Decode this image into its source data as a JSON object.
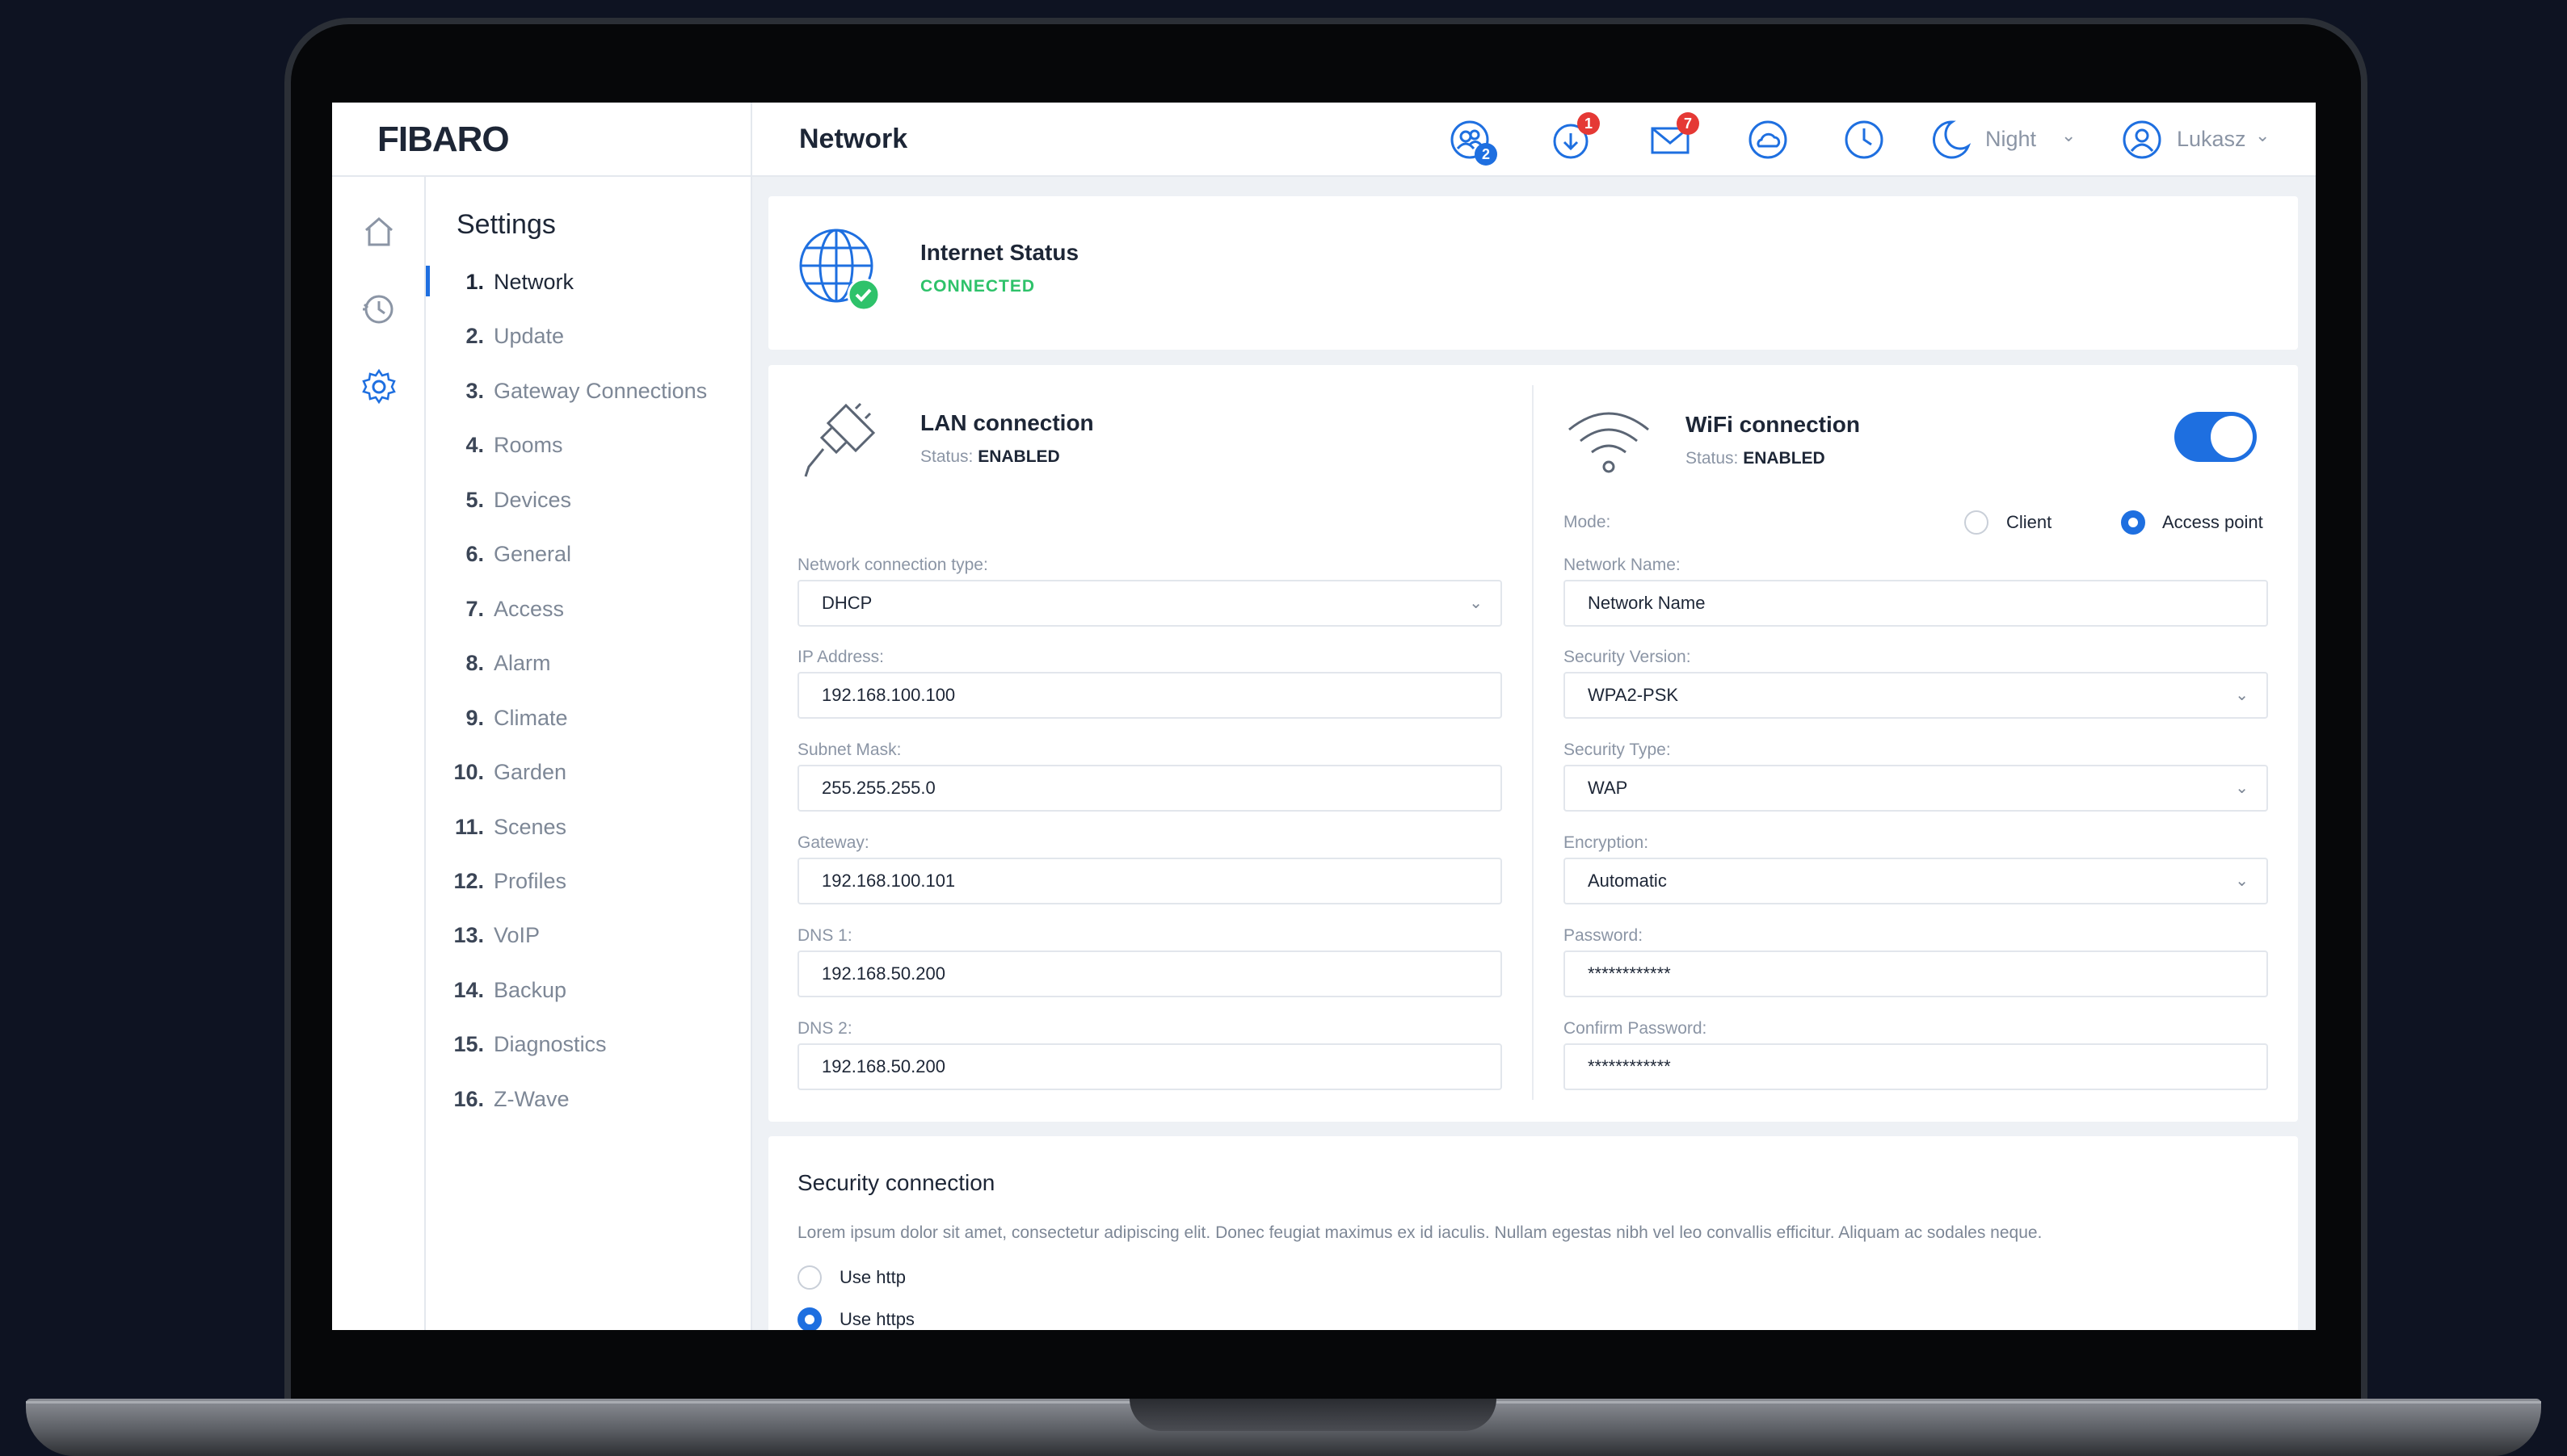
{
  "app": {
    "logo": "FIBARO",
    "page_title": "Network"
  },
  "topbar": {
    "users_badge": "2",
    "downloads_badge": "1",
    "messages_badge": "7",
    "mode_label": "Night",
    "user_label": "Lukasz"
  },
  "sidebar": {
    "title": "Settings",
    "items": [
      {
        "num": "1.",
        "label": "Network"
      },
      {
        "num": "2.",
        "label": "Update"
      },
      {
        "num": "3.",
        "label": "Gateway Connections"
      },
      {
        "num": "4.",
        "label": "Rooms"
      },
      {
        "num": "5.",
        "label": "Devices"
      },
      {
        "num": "6.",
        "label": "General"
      },
      {
        "num": "7.",
        "label": "Access"
      },
      {
        "num": "8.",
        "label": "Alarm"
      },
      {
        "num": "9.",
        "label": "Climate"
      },
      {
        "num": "10.",
        "label": "Garden"
      },
      {
        "num": "11.",
        "label": "Scenes"
      },
      {
        "num": "12.",
        "label": "Profiles"
      },
      {
        "num": "13.",
        "label": "VoIP"
      },
      {
        "num": "14.",
        "label": "Backup"
      },
      {
        "num": "15.",
        "label": "Diagnostics"
      },
      {
        "num": "16.",
        "label": "Z-Wave"
      }
    ]
  },
  "internet": {
    "title": "Internet Status",
    "status": "CONNECTED"
  },
  "lan": {
    "title": "LAN connection",
    "status_prefix": "Status:",
    "status": "ENABLED",
    "conn_type_label": "Network connection type:",
    "conn_type_value": "DHCP",
    "ip_label": "IP Address:",
    "ip_value": "192.168.100.100",
    "mask_label": "Subnet Mask:",
    "mask_value": "255.255.255.0",
    "gateway_label": "Gateway:",
    "gateway_value": "192.168.100.101",
    "dns1_label": "DNS 1:",
    "dns1_value": "192.168.50.200",
    "dns2_label": "DNS 2:",
    "dns2_value": "192.168.50.200"
  },
  "wifi": {
    "title": "WiFi connection",
    "status_prefix": "Status:",
    "status": "ENABLED",
    "enabled": true,
    "mode_label": "Mode:",
    "mode_client": "Client",
    "mode_ap": "Access point",
    "mode_selected": "Access point",
    "name_label": "Network Name:",
    "name_value": "Network Name",
    "sec_version_label": "Security Version:",
    "sec_version_value": "WPA2-PSK",
    "sec_type_label": "Security Type:",
    "sec_type_value": "WAP",
    "encryption_label": "Encryption:",
    "encryption_value": "Automatic",
    "password_label": "Password:",
    "password_value": "************",
    "confirm_label": "Confirm Password:",
    "confirm_value": "************"
  },
  "security": {
    "title": "Security connection",
    "description": "Lorem ipsum dolor sit amet, consectetur adipiscing elit. Donec feugiat maximus ex id iaculis. Nullam egestas nibh vel leo convallis efficitur. Aliquam ac sodales neque.",
    "option_http": "Use http",
    "option_https": "Use https",
    "selected": "Use https"
  },
  "colors": {
    "accent": "#1e6fe0",
    "success": "#2ec26a",
    "alert": "#e53935"
  }
}
